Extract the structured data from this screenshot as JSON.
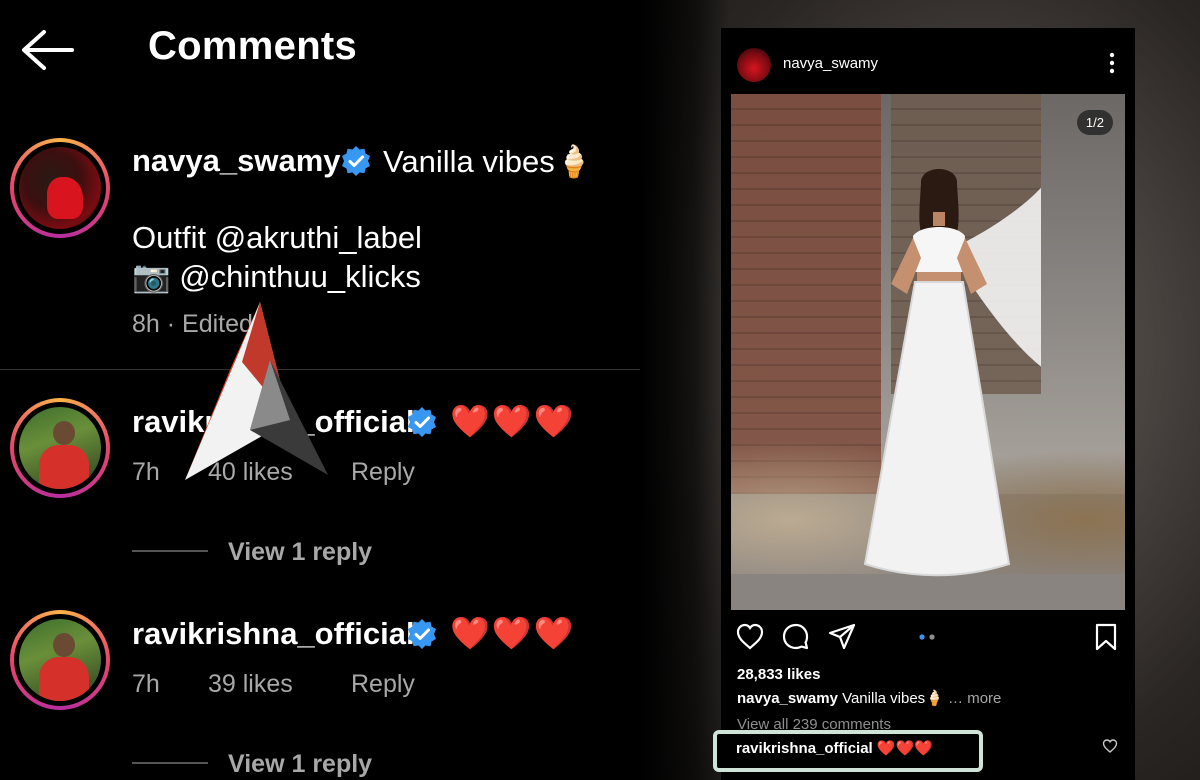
{
  "header": {
    "title": "Comments"
  },
  "caption_comment": {
    "username": "navya_swamy",
    "text": "Vanilla vibes🍦",
    "line2": "Outfit @akruthi_label",
    "line3": "📷 @chinthuu_klicks",
    "meta": "8h · Edited"
  },
  "comments": [
    {
      "username": "ravikrishna_official",
      "hearts": "❤️❤️❤️",
      "time": "7h",
      "likes": "40 likes",
      "reply": "Reply",
      "view_replies": "View 1 reply"
    },
    {
      "username": "ravikrishna_official",
      "hearts": "❤️❤️❤️",
      "time": "7h",
      "likes": "39 likes",
      "reply": "Reply",
      "view_replies": "View 1 reply"
    }
  ],
  "post": {
    "username": "navya_swamy",
    "image_counter": "1/2",
    "likes": "28,833 likes",
    "caption_user": "navya_swamy",
    "caption_text": "Vanilla vibes🍦",
    "caption_more": "… more",
    "view_all": "View all 239 comments",
    "highlight_user": "ravikrishna_official",
    "highlight_hearts": "❤️❤️❤️"
  },
  "colors": {
    "verified": "#3897f0",
    "heart": "#e8202f",
    "muted": "#a8a8a8"
  }
}
